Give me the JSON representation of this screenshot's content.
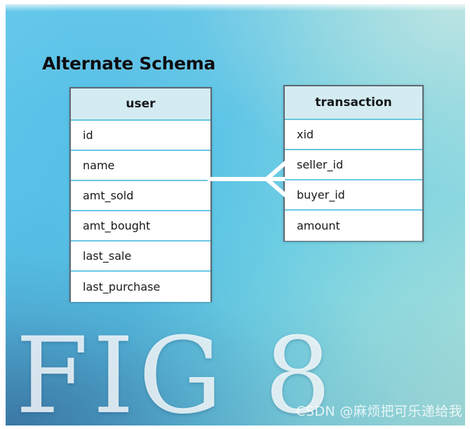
{
  "diagram": {
    "title": "Alternate Schema",
    "background": {
      "gradient_from": "#5fc6ea",
      "gradient_to": "#a6dfdb",
      "corner_dark": "#3c76a2"
    },
    "entities": [
      {
        "id": "user",
        "name": "user",
        "fields": [
          "id",
          "name",
          "amt_sold",
          "amt_bought",
          "last_sale",
          "last_purchase"
        ]
      },
      {
        "id": "transaction",
        "name": "transaction",
        "fields": [
          "xid",
          "seller_id",
          "buyer_id",
          "amount"
        ]
      }
    ],
    "relationships": [
      {
        "id": "user-transaction",
        "from": "user",
        "to": "transaction",
        "style": "crow-foot",
        "line_color": "#ffffff",
        "label": ""
      }
    ]
  },
  "figure": {
    "label": "FIG 8"
  },
  "watermark": {
    "text": "CSDN @麻烦把可乐递给我"
  }
}
